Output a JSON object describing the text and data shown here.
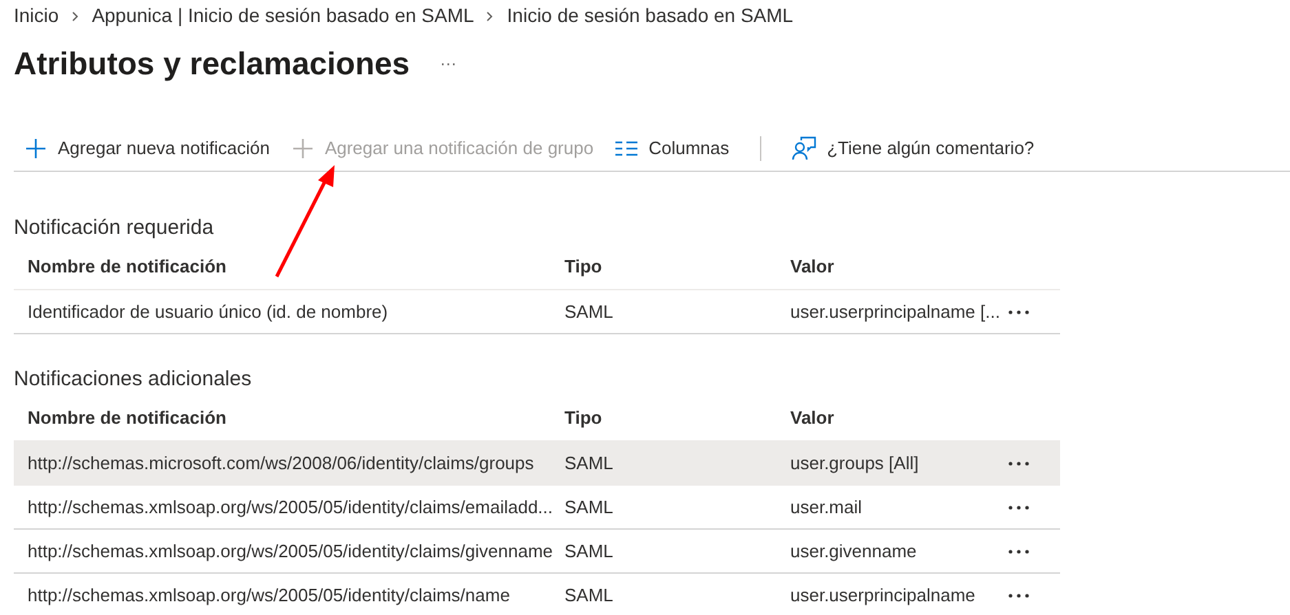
{
  "breadcrumb": [
    "Inicio",
    "Appunica | Inicio de sesión basado en SAML",
    "Inicio de sesión basado en SAML"
  ],
  "title": "Atributos y reclamaciones",
  "more": "···",
  "toolbar": [
    {
      "kind": "add",
      "label": "Agregar nueva notificación",
      "disabled": false
    },
    {
      "kind": "add",
      "label": "Agregar una notificación de grupo",
      "disabled": true
    },
    {
      "kind": "columns",
      "label": "Columnas",
      "disabled": false
    },
    {
      "kind": "feedback",
      "label": "¿Tiene algún comentario?",
      "disabled": false
    }
  ],
  "sections": [
    {
      "heading": "Notificación requerida",
      "columns": [
        "Nombre de notificación",
        "Tipo",
        "Valor"
      ],
      "rows": [
        {
          "name": "Identificador de usuario único (id. de nombre)",
          "type": "SAML",
          "value": "user.userprincipalname [...",
          "selected": false
        }
      ]
    },
    {
      "heading": "Notificaciones adicionales",
      "columns": [
        "Nombre de notificación",
        "Tipo",
        "Valor"
      ],
      "rows": [
        {
          "name": "http://schemas.microsoft.com/ws/2008/06/identity/claims/groups",
          "type": "SAML",
          "value": "user.groups [All]",
          "selected": true
        },
        {
          "name": "http://schemas.xmlsoap.org/ws/2005/05/identity/claims/emailadd...",
          "type": "SAML",
          "value": "user.mail",
          "selected": false
        },
        {
          "name": "http://schemas.xmlsoap.org/ws/2005/05/identity/claims/givenname",
          "type": "SAML",
          "value": "user.givenname",
          "selected": false
        },
        {
          "name": "http://schemas.xmlsoap.org/ws/2005/05/identity/claims/name",
          "type": "SAML",
          "value": "user.userprincipalname",
          "selected": false
        }
      ]
    }
  ]
}
